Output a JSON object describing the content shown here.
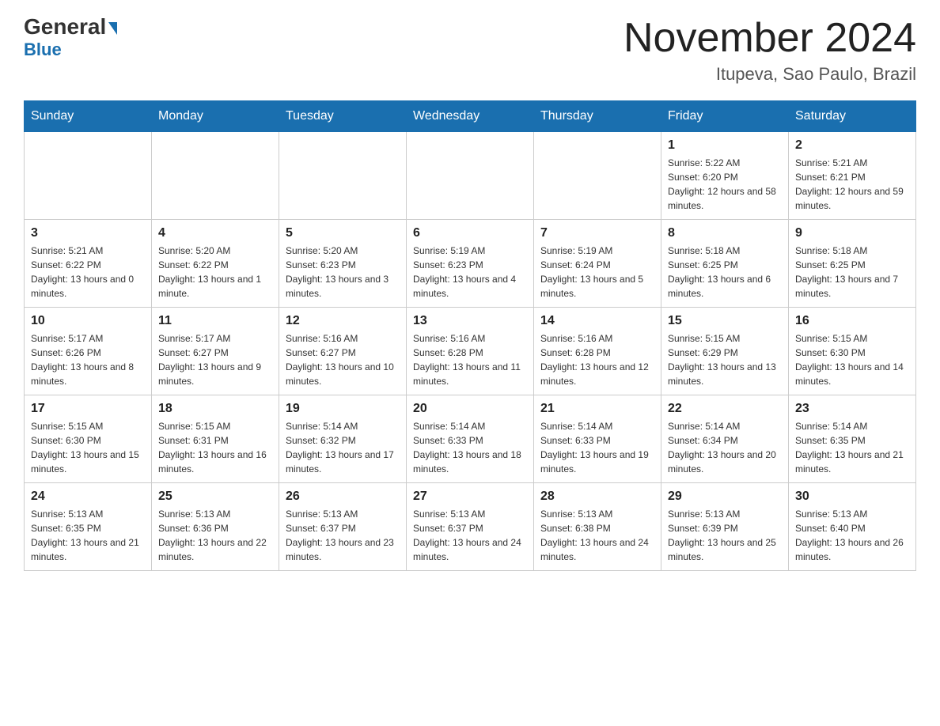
{
  "header": {
    "logo": {
      "general": "General",
      "triangle": "▶",
      "blue": "Blue"
    },
    "title": "November 2024",
    "location": "Itupeva, Sao Paulo, Brazil"
  },
  "days_of_week": [
    "Sunday",
    "Monday",
    "Tuesday",
    "Wednesday",
    "Thursday",
    "Friday",
    "Saturday"
  ],
  "weeks": [
    [
      {
        "day": "",
        "sunrise": "",
        "sunset": "",
        "daylight": ""
      },
      {
        "day": "",
        "sunrise": "",
        "sunset": "",
        "daylight": ""
      },
      {
        "day": "",
        "sunrise": "",
        "sunset": "",
        "daylight": ""
      },
      {
        "day": "",
        "sunrise": "",
        "sunset": "",
        "daylight": ""
      },
      {
        "day": "",
        "sunrise": "",
        "sunset": "",
        "daylight": ""
      },
      {
        "day": "1",
        "sunrise": "Sunrise: 5:22 AM",
        "sunset": "Sunset: 6:20 PM",
        "daylight": "Daylight: 12 hours and 58 minutes."
      },
      {
        "day": "2",
        "sunrise": "Sunrise: 5:21 AM",
        "sunset": "Sunset: 6:21 PM",
        "daylight": "Daylight: 12 hours and 59 minutes."
      }
    ],
    [
      {
        "day": "3",
        "sunrise": "Sunrise: 5:21 AM",
        "sunset": "Sunset: 6:22 PM",
        "daylight": "Daylight: 13 hours and 0 minutes."
      },
      {
        "day": "4",
        "sunrise": "Sunrise: 5:20 AM",
        "sunset": "Sunset: 6:22 PM",
        "daylight": "Daylight: 13 hours and 1 minute."
      },
      {
        "day": "5",
        "sunrise": "Sunrise: 5:20 AM",
        "sunset": "Sunset: 6:23 PM",
        "daylight": "Daylight: 13 hours and 3 minutes."
      },
      {
        "day": "6",
        "sunrise": "Sunrise: 5:19 AM",
        "sunset": "Sunset: 6:23 PM",
        "daylight": "Daylight: 13 hours and 4 minutes."
      },
      {
        "day": "7",
        "sunrise": "Sunrise: 5:19 AM",
        "sunset": "Sunset: 6:24 PM",
        "daylight": "Daylight: 13 hours and 5 minutes."
      },
      {
        "day": "8",
        "sunrise": "Sunrise: 5:18 AM",
        "sunset": "Sunset: 6:25 PM",
        "daylight": "Daylight: 13 hours and 6 minutes."
      },
      {
        "day": "9",
        "sunrise": "Sunrise: 5:18 AM",
        "sunset": "Sunset: 6:25 PM",
        "daylight": "Daylight: 13 hours and 7 minutes."
      }
    ],
    [
      {
        "day": "10",
        "sunrise": "Sunrise: 5:17 AM",
        "sunset": "Sunset: 6:26 PM",
        "daylight": "Daylight: 13 hours and 8 minutes."
      },
      {
        "day": "11",
        "sunrise": "Sunrise: 5:17 AM",
        "sunset": "Sunset: 6:27 PM",
        "daylight": "Daylight: 13 hours and 9 minutes."
      },
      {
        "day": "12",
        "sunrise": "Sunrise: 5:16 AM",
        "sunset": "Sunset: 6:27 PM",
        "daylight": "Daylight: 13 hours and 10 minutes."
      },
      {
        "day": "13",
        "sunrise": "Sunrise: 5:16 AM",
        "sunset": "Sunset: 6:28 PM",
        "daylight": "Daylight: 13 hours and 11 minutes."
      },
      {
        "day": "14",
        "sunrise": "Sunrise: 5:16 AM",
        "sunset": "Sunset: 6:28 PM",
        "daylight": "Daylight: 13 hours and 12 minutes."
      },
      {
        "day": "15",
        "sunrise": "Sunrise: 5:15 AM",
        "sunset": "Sunset: 6:29 PM",
        "daylight": "Daylight: 13 hours and 13 minutes."
      },
      {
        "day": "16",
        "sunrise": "Sunrise: 5:15 AM",
        "sunset": "Sunset: 6:30 PM",
        "daylight": "Daylight: 13 hours and 14 minutes."
      }
    ],
    [
      {
        "day": "17",
        "sunrise": "Sunrise: 5:15 AM",
        "sunset": "Sunset: 6:30 PM",
        "daylight": "Daylight: 13 hours and 15 minutes."
      },
      {
        "day": "18",
        "sunrise": "Sunrise: 5:15 AM",
        "sunset": "Sunset: 6:31 PM",
        "daylight": "Daylight: 13 hours and 16 minutes."
      },
      {
        "day": "19",
        "sunrise": "Sunrise: 5:14 AM",
        "sunset": "Sunset: 6:32 PM",
        "daylight": "Daylight: 13 hours and 17 minutes."
      },
      {
        "day": "20",
        "sunrise": "Sunrise: 5:14 AM",
        "sunset": "Sunset: 6:33 PM",
        "daylight": "Daylight: 13 hours and 18 minutes."
      },
      {
        "day": "21",
        "sunrise": "Sunrise: 5:14 AM",
        "sunset": "Sunset: 6:33 PM",
        "daylight": "Daylight: 13 hours and 19 minutes."
      },
      {
        "day": "22",
        "sunrise": "Sunrise: 5:14 AM",
        "sunset": "Sunset: 6:34 PM",
        "daylight": "Daylight: 13 hours and 20 minutes."
      },
      {
        "day": "23",
        "sunrise": "Sunrise: 5:14 AM",
        "sunset": "Sunset: 6:35 PM",
        "daylight": "Daylight: 13 hours and 21 minutes."
      }
    ],
    [
      {
        "day": "24",
        "sunrise": "Sunrise: 5:13 AM",
        "sunset": "Sunset: 6:35 PM",
        "daylight": "Daylight: 13 hours and 21 minutes."
      },
      {
        "day": "25",
        "sunrise": "Sunrise: 5:13 AM",
        "sunset": "Sunset: 6:36 PM",
        "daylight": "Daylight: 13 hours and 22 minutes."
      },
      {
        "day": "26",
        "sunrise": "Sunrise: 5:13 AM",
        "sunset": "Sunset: 6:37 PM",
        "daylight": "Daylight: 13 hours and 23 minutes."
      },
      {
        "day": "27",
        "sunrise": "Sunrise: 5:13 AM",
        "sunset": "Sunset: 6:37 PM",
        "daylight": "Daylight: 13 hours and 24 minutes."
      },
      {
        "day": "28",
        "sunrise": "Sunrise: 5:13 AM",
        "sunset": "Sunset: 6:38 PM",
        "daylight": "Daylight: 13 hours and 24 minutes."
      },
      {
        "day": "29",
        "sunrise": "Sunrise: 5:13 AM",
        "sunset": "Sunset: 6:39 PM",
        "daylight": "Daylight: 13 hours and 25 minutes."
      },
      {
        "day": "30",
        "sunrise": "Sunrise: 5:13 AM",
        "sunset": "Sunset: 6:40 PM",
        "daylight": "Daylight: 13 hours and 26 minutes."
      }
    ]
  ]
}
